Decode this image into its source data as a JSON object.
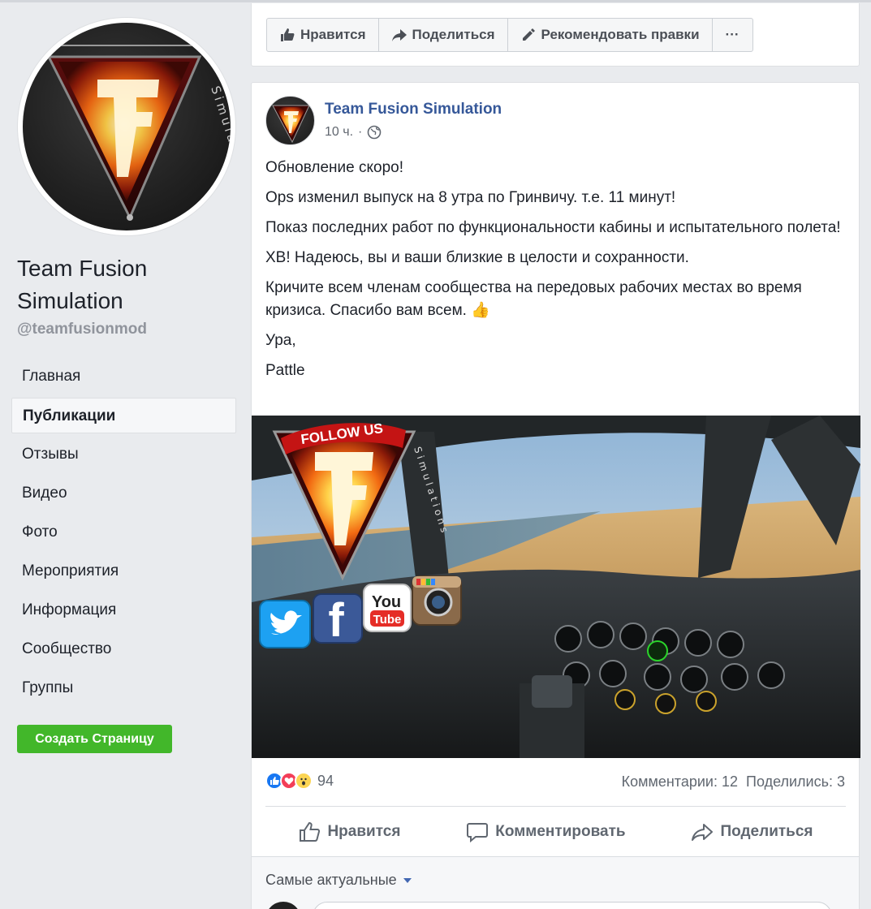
{
  "page": {
    "name": "Team Fusion Simulation",
    "handle": "@teamfusionmod",
    "logo_text": "Simulation"
  },
  "nav": {
    "items": [
      {
        "label": "Главная"
      },
      {
        "label": "Публикации",
        "active": true
      },
      {
        "label": "Отзывы"
      },
      {
        "label": "Видео"
      },
      {
        "label": "Фото"
      },
      {
        "label": "Мероприятия"
      },
      {
        "label": "Информация"
      },
      {
        "label": "Сообщество"
      },
      {
        "label": "Группы"
      }
    ],
    "create_page_label": "Создать Страницу"
  },
  "action_bar": {
    "like_label": "Нравится",
    "share_label": "Поделиться",
    "suggest_label": "Рекомендовать правки",
    "more_label": "···"
  },
  "post": {
    "author": "Team Fusion Simulation",
    "time": "10 ч.",
    "separator": "·",
    "paragraphs": [
      "Обновление скоро!",
      "Ops изменил выпуск на 8 утра по Гринвичу. т.е. 11 минут!",
      "Показ последних работ по функциональности кабины и испытательного полета!",
      "ХВ! Надеюсь, вы и ваши близкие в целости и сохранности.",
      "Кричите всем членам сообщества на передовых рабочих местах во время кризиса. Спасибо вам всем. 👍",
      "Ура,",
      "Pattle"
    ],
    "image": {
      "follow_us": "FOLLOW US",
      "youtube_top": "You",
      "youtube_bottom": "Tube",
      "logo_text": "Simulations"
    },
    "reactions_count": "94",
    "comments": "Комментарии: 12",
    "shares": "Поделились: 3",
    "like_action": "Нравится",
    "comment_action": "Комментировать",
    "share_action": "Поделиться",
    "sort_label": "Самые актуальные"
  },
  "colors": {
    "brand_blue": "#4267b2",
    "link_blue": "#365899",
    "green": "#42b72a",
    "background": "#e9ebee"
  }
}
